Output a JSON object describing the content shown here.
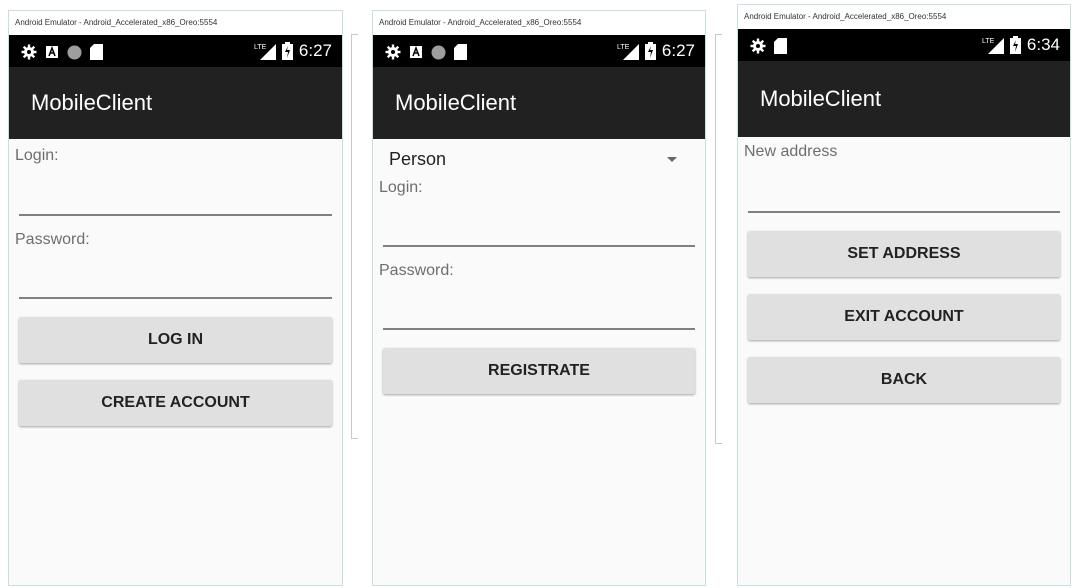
{
  "windows": [
    {
      "title": "Android Emulator - Android_Accelerated_x86_Oreo:5554",
      "status_time": "6:27",
      "app_title": "MobileClient",
      "login_label": "Login:",
      "password_label": "Password:",
      "login_button": "LOG IN",
      "create_button": "CREATE ACCOUNT"
    },
    {
      "title": "Android Emulator - Android_Accelerated_x86_Oreo:5554",
      "status_time": "6:27",
      "app_title": "MobileClient",
      "spinner_value": "Person",
      "login_label": "Login:",
      "password_label": "Password:",
      "registrate_button": "REGISTRATE"
    },
    {
      "title": "Android Emulator - Android_Accelerated_x86_Oreo:5554",
      "status_time": "6:34",
      "app_title": "MobileClient",
      "address_placeholder": "New address",
      "set_address_button": "SET ADDRESS",
      "exit_button": "EXIT ACCOUNT",
      "back_button": "BACK"
    }
  ],
  "status_icons": [
    "gear-icon",
    "a-notification-icon",
    "record-icon",
    "sd-card-icon",
    "lte-signal-icon",
    "battery-icon"
  ],
  "colors": {
    "app_bar": "#212121",
    "status_bar": "#000000",
    "button": "#e0e0e0",
    "background": "#fafafa"
  }
}
